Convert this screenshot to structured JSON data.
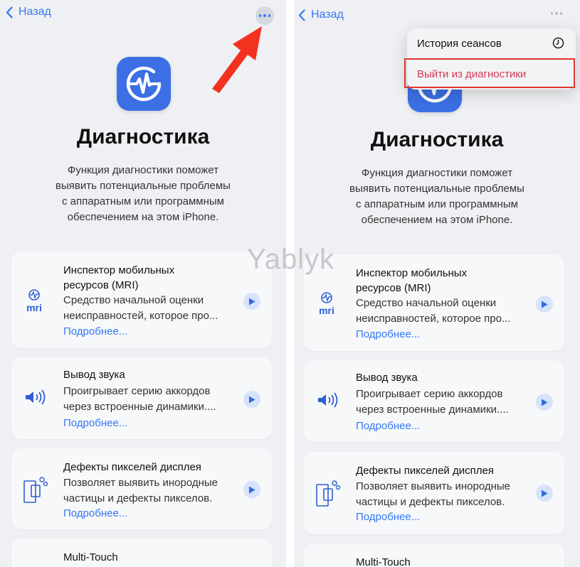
{
  "nav": {
    "back_label": "Назад"
  },
  "header": {
    "title": "Диагностика",
    "description": [
      "Функция диагностики поможет",
      "выявить потенциальные проблемы",
      "с аппаратным или программным",
      "обеспечением на этом iPhone."
    ]
  },
  "tests": [
    {
      "title_lines": [
        "Инспектор мобильных",
        "ресурсов (MRI)"
      ],
      "desc_lines": [
        "Средство начальной оценки",
        "неисправностей, которое про..."
      ],
      "link": "Подробнее...",
      "icon": "mri-icon",
      "icon_label": "mri"
    },
    {
      "title_lines": [
        "Вывод звука"
      ],
      "desc_lines": [
        "Проигрывает серию аккордов",
        "через встроенные динамики...."
      ],
      "link": "Подробнее...",
      "icon": "speaker-icon"
    },
    {
      "title_lines": [
        "Дефекты пикселей дисплея"
      ],
      "desc_lines": [
        "Позволяет выявить инородные",
        "частицы и дефекты пикселов."
      ],
      "link": "Подробнее...",
      "icon": "display-pixels-icon"
    },
    {
      "title_lines": [
        "Multi-Touch"
      ]
    }
  ],
  "menu": {
    "items": [
      {
        "label": "История сеансов",
        "icon": "clock-icon"
      },
      {
        "label": "Выйти из диагностики"
      }
    ]
  },
  "watermark": "Yablyk",
  "colors": {
    "accent": "#3478f6",
    "app_icon": "#3b6fe3",
    "destructive": "#d63a55",
    "highlight": "#e0362c",
    "arrow": "#f2321f"
  }
}
